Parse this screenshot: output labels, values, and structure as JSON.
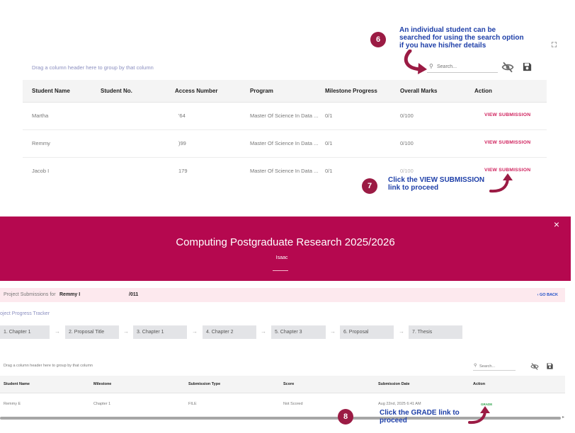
{
  "top_grid": {
    "drag_hint": "Drag a column header here to group by that column",
    "search_placeholder": "Search...",
    "columns": [
      "Student Name",
      "Student No.",
      "Access Number",
      "Program",
      "Milestone Progress",
      "Overall Marks",
      "Action"
    ],
    "rows": [
      {
        "name": "Martha",
        "access": "'64",
        "program": "Master Of Science In Data ...",
        "milestone": "0/1",
        "marks": "0/100",
        "action": "VIEW SUBMISSION"
      },
      {
        "name": "Remmy",
        "access": ")99",
        "program": "Master Of Science In Data ...",
        "milestone": "0/1",
        "marks": "0/100",
        "action": "VIEW SUBMISSION"
      },
      {
        "name": "Jacob I",
        "access": "179",
        "program": "Master Of Science In Data ...",
        "milestone": "0/1",
        "marks": "0/100",
        "action": "VIEW SUBMISSION"
      }
    ]
  },
  "callouts": {
    "six": {
      "num": "6",
      "line1": "An individual student can be",
      "line2": "searched for using the search option",
      "line3": "if you have his/her details"
    },
    "seven": {
      "num": "7",
      "line1": "Click the VIEW SUBMISSION",
      "line2": "link to proceed"
    },
    "eight": {
      "num": "8",
      "line1": "Click the GRADE link to",
      "line2": "proceed"
    }
  },
  "banner": {
    "title": "Computing Postgraduate Research 2025/2026",
    "subtitle": "Isaac",
    "close": "×"
  },
  "submissions": {
    "prefix": "Project Submissions for",
    "student": "Remmy I",
    "number": "/011",
    "back": "‹ GO BACK"
  },
  "tracker": {
    "title": "oject Progress Tracker",
    "arrow": "→",
    "steps": [
      "1. Chapter 1",
      "2. Proposal Title",
      "3. Chapter 1",
      "4. Chapter 2",
      "5. Chapter 3",
      "6. Proposal",
      "7. Thesis"
    ]
  },
  "bottom_grid": {
    "drag_hint": "Drag a column header here to group by that column",
    "search_placeholder": "Search...",
    "columns": [
      "Student Name",
      "Milestone",
      "Submission Type",
      "Score",
      "Submission Date",
      "Action"
    ],
    "row": {
      "name": "Remmy E",
      "milestone": "Chapter 1",
      "type": "FILE",
      "score": "Not Scored",
      "date": "Aug 22nd, 2025 6:41 AM",
      "action": "GRADE"
    }
  },
  "colors": {
    "brand": "#b5084f",
    "callout_text": "#1e3fa8",
    "badge": "#9b1b44",
    "link": "#d0245f",
    "grade": "#2da34a"
  }
}
